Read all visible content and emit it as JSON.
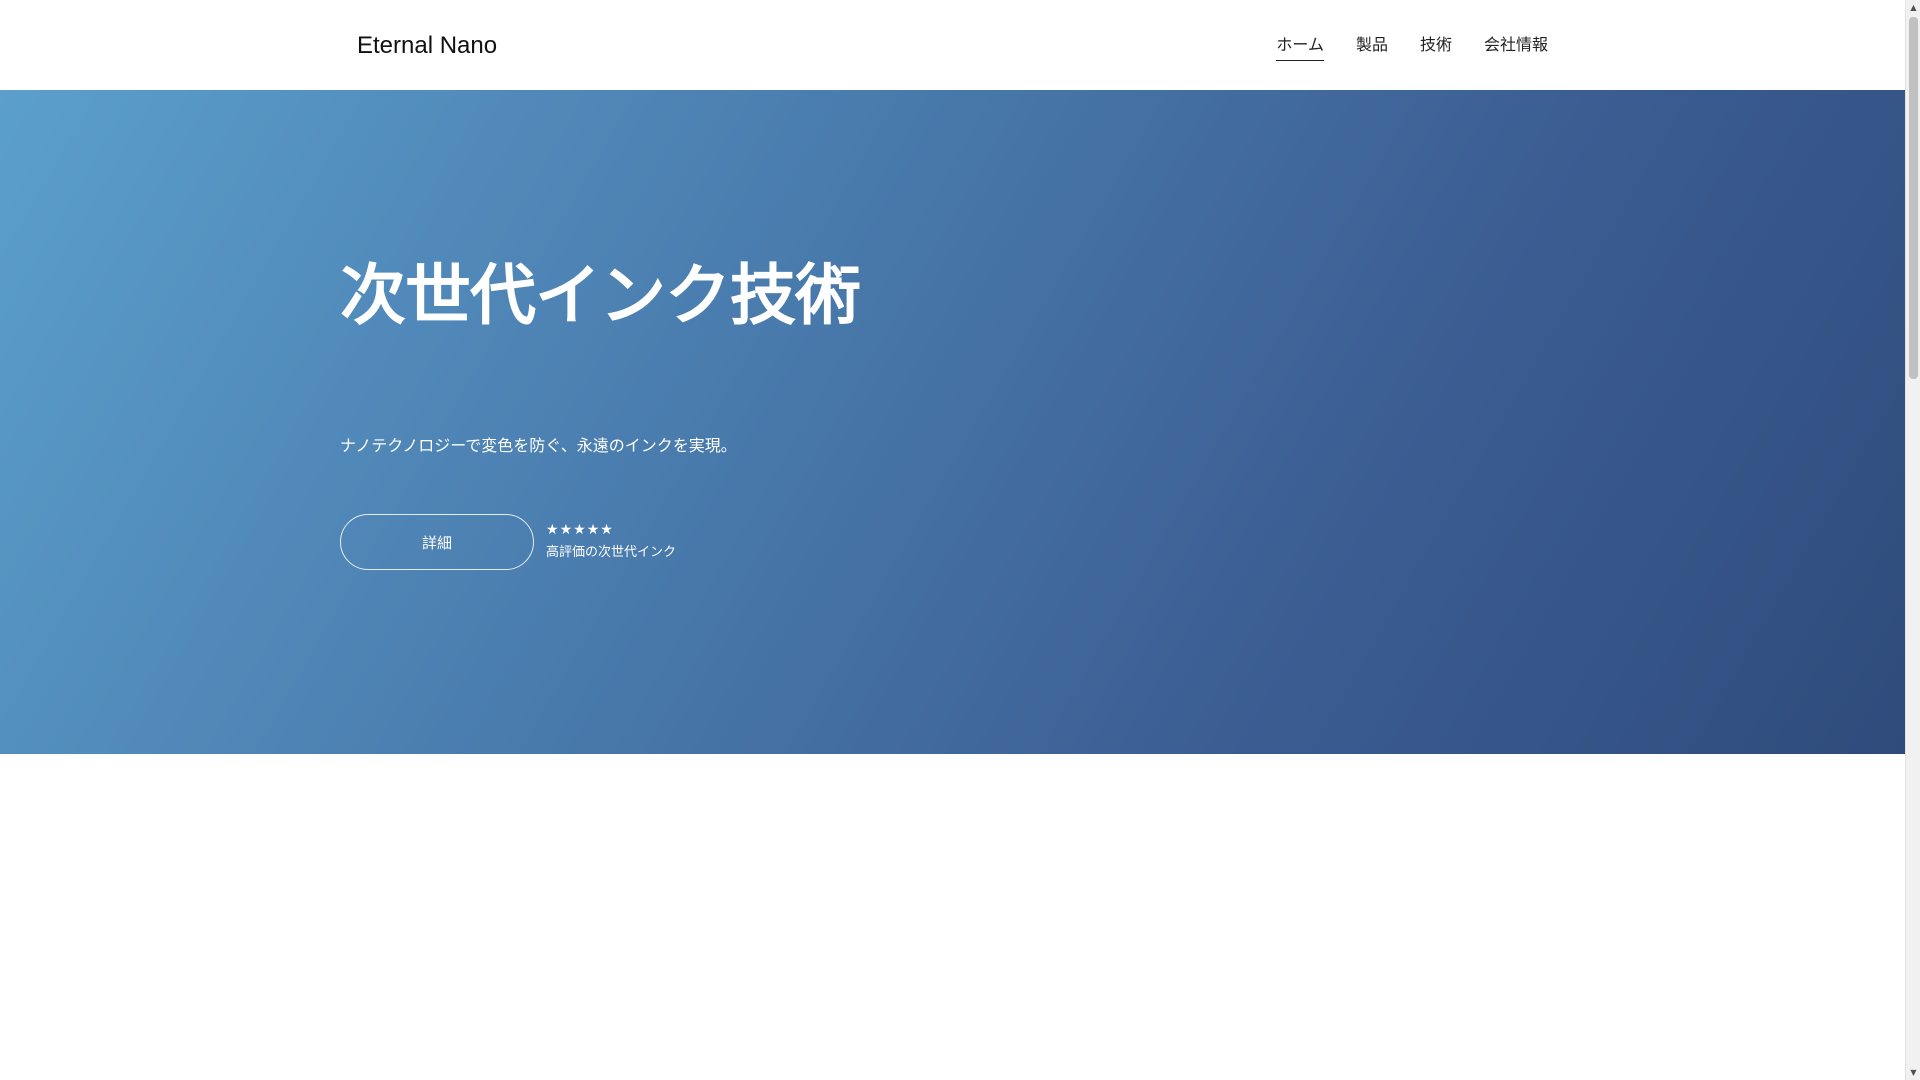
{
  "header": {
    "logo": "Eternal Nano",
    "nav": [
      {
        "label": "ホーム",
        "active": true
      },
      {
        "label": "製品",
        "active": false
      },
      {
        "label": "技術",
        "active": false
      },
      {
        "label": "会社情報",
        "active": false
      }
    ]
  },
  "hero": {
    "title": "次世代インク技術",
    "subtitle": "ナノテクノロジーで変色を防ぐ、永遠のインクを実現。",
    "cta_label": "詳細",
    "rating": {
      "stars": 5,
      "star_glyph": "★",
      "caption": "高評価の次世代インク"
    },
    "gradient_colors": [
      "#5b9fcc",
      "#2f4b7c"
    ]
  },
  "scrollbar": {
    "up_icon": "triangle-up-icon",
    "down_icon": "triangle-down-icon"
  }
}
